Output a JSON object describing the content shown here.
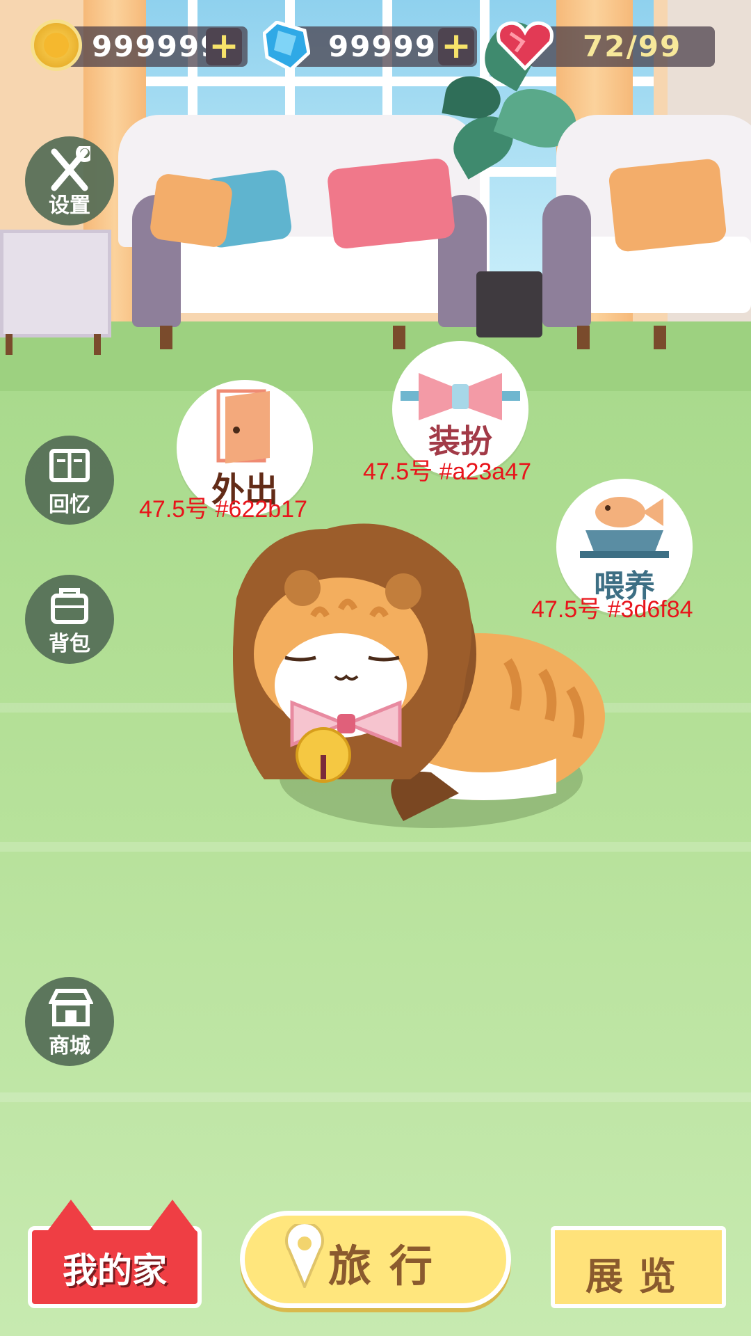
{
  "hud": {
    "coins": "999999",
    "gems": "99999",
    "energy": "72/99"
  },
  "side_menu": {
    "settings": "设置",
    "memories": "回忆",
    "backpack": "背包",
    "shop": "商城"
  },
  "actions": {
    "go_out": {
      "label": "外出",
      "annotation": "47.5号  #622b17",
      "color": "#622b17"
    },
    "dress_up": {
      "label": "装扮",
      "annotation": "47.5号  #a23a47",
      "color": "#a23a47"
    },
    "feed": {
      "label": "喂养",
      "annotation": "47.5号  #3d6f84",
      "color": "#3d6f84"
    }
  },
  "bottom_nav": {
    "home": "我的家",
    "travel": "旅行",
    "exhibition": "展览"
  },
  "colors": {
    "floor": "#b4e097",
    "side_button": "#546c56",
    "home_tab": "#ef3e44",
    "travel_tab": "#ffe67d",
    "annotation": "#e8141b"
  },
  "icons": [
    "coin-icon",
    "gem-icon",
    "heart-icon",
    "plus-icon",
    "tools-icon",
    "book-icon",
    "bag-icon",
    "store-icon",
    "door-icon",
    "bow-icon",
    "fish-bowl-icon",
    "location-pin-icon"
  ]
}
